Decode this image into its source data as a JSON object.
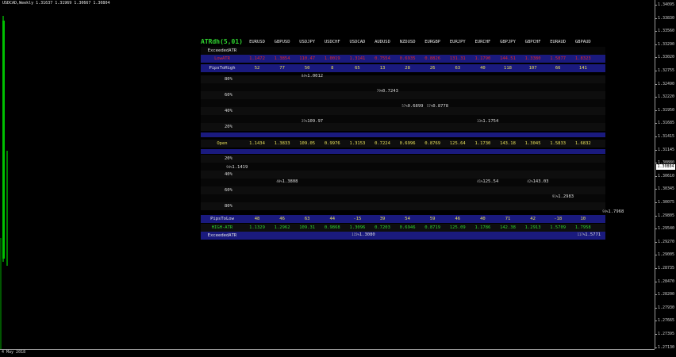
{
  "window_title": "USDCAD,Weekly  1.31637 1.31969 1.30667 1.30804",
  "date_label": "4 May 2018",
  "price_axis": {
    "labels": [
      "1.34095",
      "1.33830",
      "1.33560",
      "1.33290",
      "1.33020",
      "1.32755",
      "1.32490",
      "1.32220",
      "1.31950",
      "1.31685",
      "1.31415",
      "1.31145",
      "1.30880",
      "1.30610",
      "1.30345",
      "1.30075",
      "1.29805",
      "1.29540",
      "1.29270",
      "1.29005",
      "1.28735",
      "1.28470",
      "1.28200",
      "1.27930",
      "1.27665",
      "1.27395",
      "1.27130"
    ],
    "current": "1.30804"
  },
  "colors": {
    "navy": "#1a1a7e",
    "red": "#e02a2a",
    "green": "#2fd52f",
    "yellow": "#e8e05a",
    "white": "#e6e6e6"
  },
  "panel": {
    "title": "ATRdh(5,01)",
    "symbols": [
      "EURUSD",
      "GBPUSD",
      "USDJPY",
      "USDCHF",
      "USDCAD",
      "AUDUSD",
      "NZDUSD",
      "EURGBP",
      "EURJPY",
      "EURCHF",
      "GBPJPY",
      "GBPCHF",
      "EURAUD",
      "GBPAUD"
    ],
    "exceeded_top_label": "ExceededATR",
    "lowatr_label": "LowATR",
    "lowatr": [
      "1.1472",
      "1.3854",
      "110.47",
      "1.0019",
      "1.3141",
      "0.7554",
      "0.6935",
      "0.8826",
      "131.31",
      "1.1790",
      "144.51",
      "1.3380",
      "1.5877",
      "1.8323"
    ],
    "pipstohigh_label": "PipsToHigh",
    "pipstohigh": [
      "52",
      "77",
      "50",
      "8",
      "65",
      "13",
      "28",
      "26",
      "63",
      "40",
      "118",
      "107",
      "66",
      "141"
    ],
    "high_pct_labels": [
      "80%",
      "60%",
      "40%",
      "20%"
    ],
    "open_label": "Open",
    "open": [
      "1.1434",
      "1.3833",
      "109.05",
      "0.9976",
      "1.3153",
      "0.7224",
      "0.6996",
      "0.8769",
      "125.64",
      "1.1730",
      "143.18",
      "1.3045",
      "1.5833",
      "1.6832"
    ],
    "low_pct_labels": [
      "20%",
      "40%",
      "60%",
      "80%"
    ],
    "pipstolow_label": "PipsToLow",
    "pipstolow": [
      "48",
      "46",
      "63",
      "44",
      "-15",
      "39",
      "54",
      "59",
      "46",
      "40",
      "71",
      "42",
      "-18",
      "10"
    ],
    "highatr_label": "HIGH-ATR",
    "highatr": [
      "1.1329",
      "1.2962",
      "109.31",
      "0.9868",
      "1.3096",
      "0.7203",
      "0.6946",
      "0.8719",
      "125.09",
      "1.1786",
      "142.38",
      "1.2913",
      "1.5709",
      "1.7958"
    ],
    "exceeded_bottom_label": "ExceededATR",
    "markers_top": [
      {
        "pct": "84%",
        "val": "1.0012"
      },
      {
        "pct": "79%",
        "val": "0.7243"
      },
      {
        "pct": "57%",
        "val": "0.6899"
      },
      {
        "pct": "57%",
        "val": "0.8778"
      },
      {
        "pct": "33%",
        "val": "1.1754"
      },
      {
        "pct": "25%",
        "val": "109.97"
      }
    ],
    "markers_bottom": [
      {
        "pct": "94%",
        "val": "1.1419"
      },
      {
        "pct": "40%",
        "val": "1.3808"
      },
      {
        "pct": "41%",
        "val": "125.54"
      },
      {
        "pct": "42%",
        "val": "143.03"
      },
      {
        "pct": "91%",
        "val": "1.2983"
      },
      {
        "pct": "94%",
        "val": "1.7968"
      }
    ],
    "markers_exceeded": [
      {
        "pct": "115%",
        "val": "1.3080"
      },
      {
        "pct": "117%",
        "val": "1.5771"
      }
    ]
  }
}
